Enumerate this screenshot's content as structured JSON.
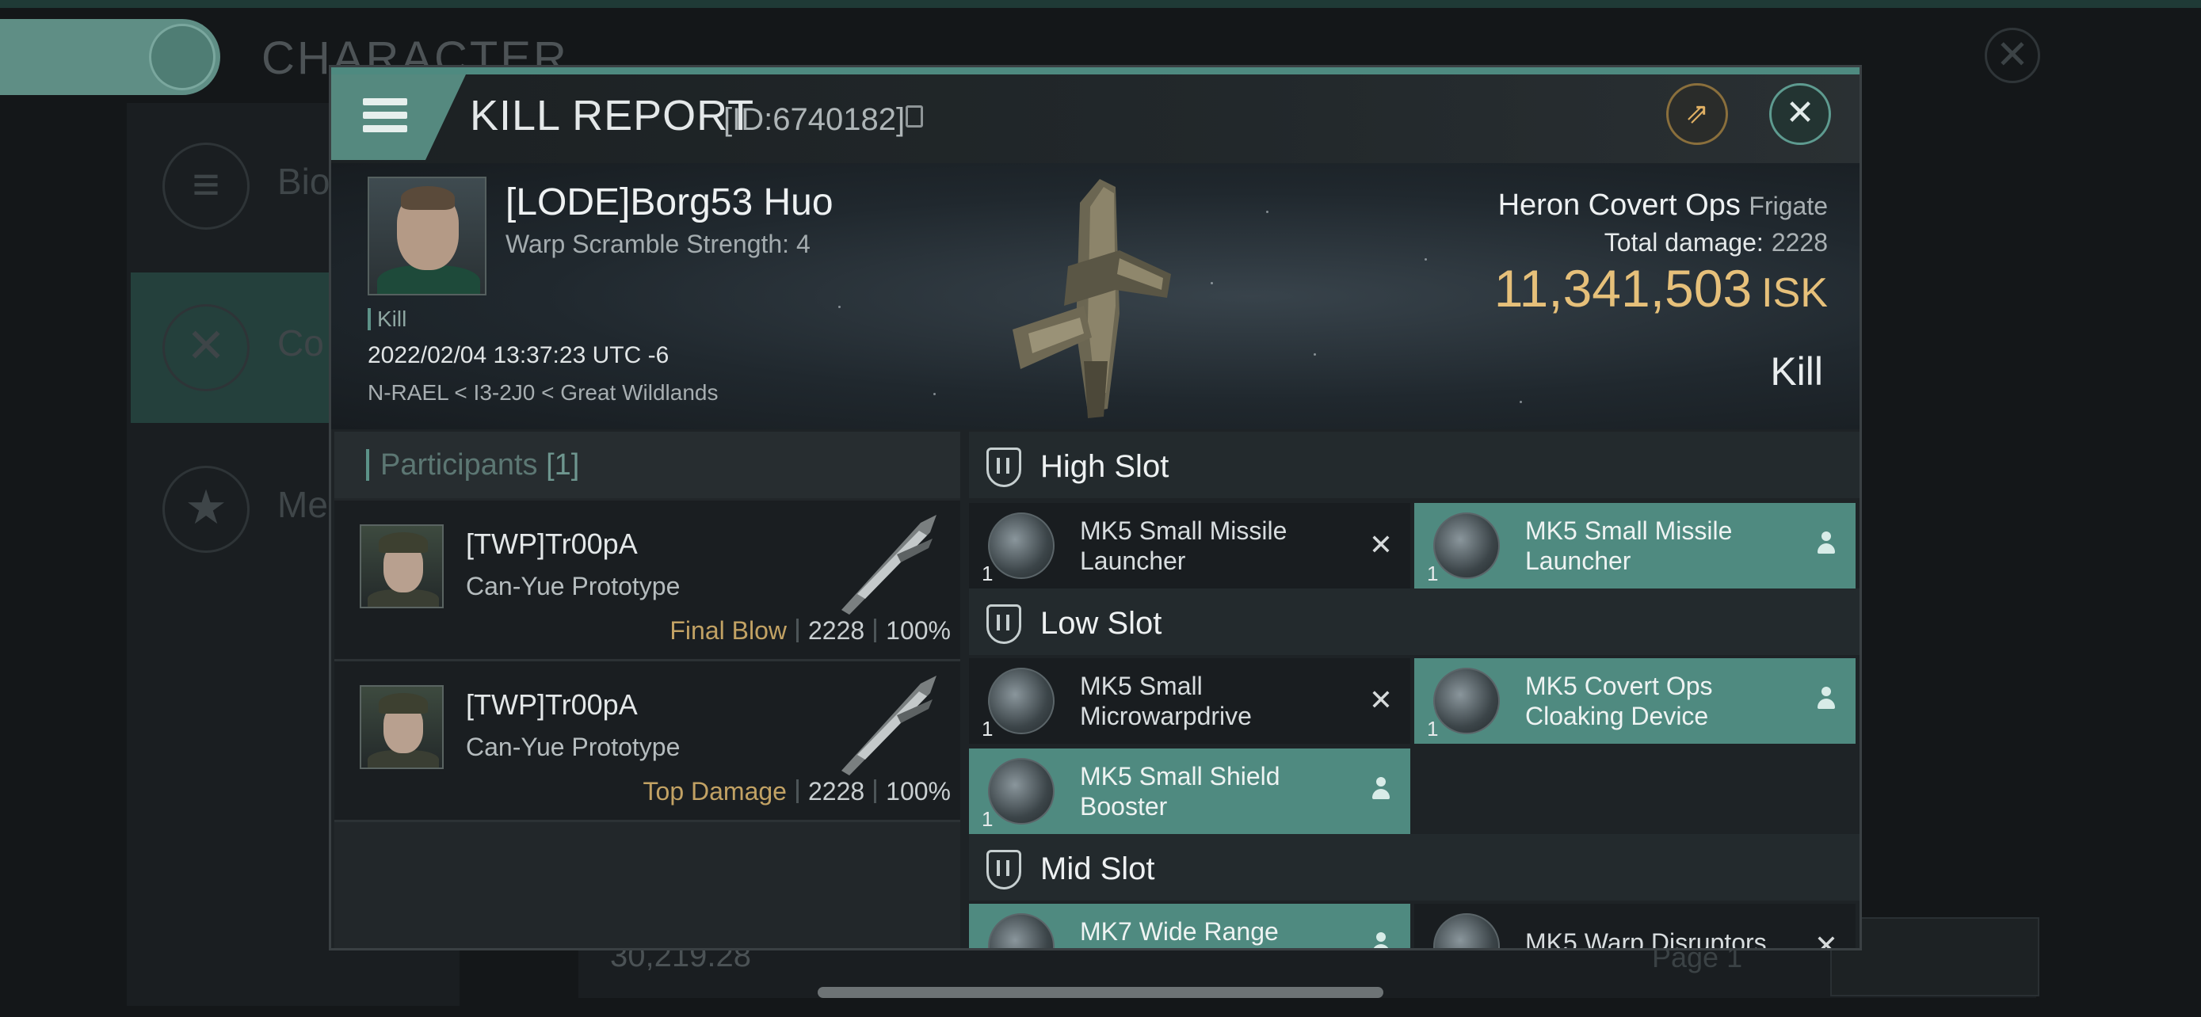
{
  "background": {
    "screen_title": "CHARACTER",
    "side_items": [
      {
        "label": "Bio"
      },
      {
        "label": "Co"
      },
      {
        "label": "Me"
      }
    ],
    "isk_value": "30,219.28",
    "page_label": "Page 1"
  },
  "dialog": {
    "title": "KILL REPORT",
    "id_text": "[ID:6740182]"
  },
  "victim": {
    "name": "[LODE]Borg53 Huo",
    "warp": "Warp Scramble Strength: 4",
    "kill_tag": "Kill",
    "time": "2022/02/04 13:37:23 UTC -6",
    "location": "N-RAEL < I3-2J0 < Great Wildlands",
    "ship_name": "Heron Covert Ops",
    "ship_class": "Frigate",
    "damage_label": "Total damage:",
    "damage_value": "2228",
    "value": "11,341,503",
    "currency": "ISK",
    "result": "Kill"
  },
  "participants": {
    "label": "Participants",
    "count": "[1]",
    "items": [
      {
        "name": "[TWP]Tr00pA",
        "ship": "Can-Yue Prototype",
        "tag": "Final Blow",
        "damage": "2228",
        "percent": "100%"
      },
      {
        "name": "[TWP]Tr00pA",
        "ship": "Can-Yue Prototype",
        "tag": "Top Damage",
        "damage": "2228",
        "percent": "100%"
      }
    ]
  },
  "slots": {
    "high": {
      "label": "High Slot",
      "modules": [
        {
          "name": "MK5 Small Missile Launcher",
          "qty": "1",
          "state": "destroyed"
        },
        {
          "name": "MK5 Small Missile Launcher",
          "qty": "1",
          "state": "dropped"
        }
      ]
    },
    "low": {
      "label": "Low Slot",
      "modules": [
        {
          "name": "MK5 Small Microwarpdrive",
          "qty": "1",
          "state": "destroyed"
        },
        {
          "name": "MK5 Covert Ops Cloaking Device",
          "qty": "1",
          "state": "dropped"
        },
        {
          "name": "MK5 Small Shield Booster",
          "qty": "1",
          "state": "dropped"
        }
      ]
    },
    "mid": {
      "label": "Mid Slot",
      "modules": [
        {
          "name": "MK7 Wide Range",
          "state": "dropped"
        },
        {
          "name": "MK5 Warp Disruptors",
          "state": "destroyed"
        }
      ]
    }
  },
  "colors": {
    "accent_teal": "#4f8a80",
    "isk_gold": "#e6c07a",
    "tag_gold": "#c2a264"
  },
  "icons": [
    "menu-icon",
    "copy-icon",
    "share-icon",
    "close-icon",
    "slot-shield-icon",
    "destroyed-x-icon",
    "dropped-person-icon",
    "filter-icon"
  ]
}
